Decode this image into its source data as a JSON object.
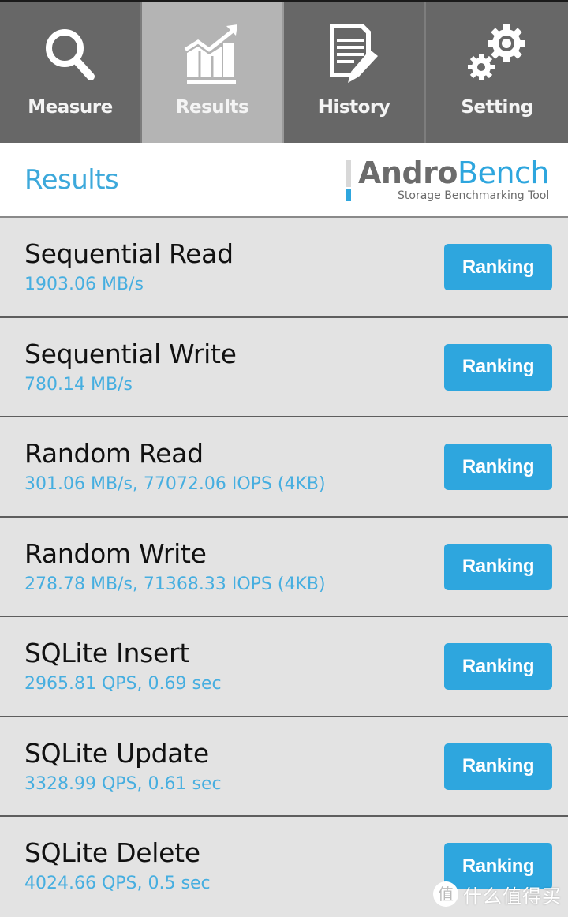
{
  "nav": {
    "tabs": [
      {
        "label": "Measure",
        "icon": "search-icon",
        "active": false
      },
      {
        "label": "Results",
        "icon": "chart-up-icon",
        "active": true
      },
      {
        "label": "History",
        "icon": "document-pencil-icon",
        "active": false
      },
      {
        "label": "Setting",
        "icon": "gears-icon",
        "active": false
      }
    ]
  },
  "header": {
    "title": "Results",
    "logo": {
      "name_part1": "Andro",
      "name_part2": "Bench",
      "tagline": "Storage Benchmarking Tool"
    }
  },
  "results": [
    {
      "name": "Sequential Read",
      "value": "1903.06 MB/s",
      "button": "Ranking"
    },
    {
      "name": "Sequential Write",
      "value": "780.14 MB/s",
      "button": "Ranking"
    },
    {
      "name": "Random Read",
      "value": "301.06 MB/s, 77072.06 IOPS (4KB)",
      "button": "Ranking"
    },
    {
      "name": "Random Write",
      "value": "278.78 MB/s, 71368.33 IOPS (4KB)",
      "button": "Ranking"
    },
    {
      "name": "SQLite Insert",
      "value": "2965.81 QPS, 0.69 sec",
      "button": "Ranking"
    },
    {
      "name": "SQLite Update",
      "value": "3328.99 QPS, 0.61 sec",
      "button": "Ranking"
    },
    {
      "name": "SQLite Delete",
      "value": "4024.66 QPS, 0.5 sec",
      "button": "Ranking"
    }
  ],
  "watermark": {
    "glyph": "值",
    "text": "什么值得买"
  },
  "colors": {
    "accent": "#2ea6de",
    "value_text": "#46aee0",
    "tabbar": "#676767",
    "tab_active": "#b4b4b4"
  }
}
